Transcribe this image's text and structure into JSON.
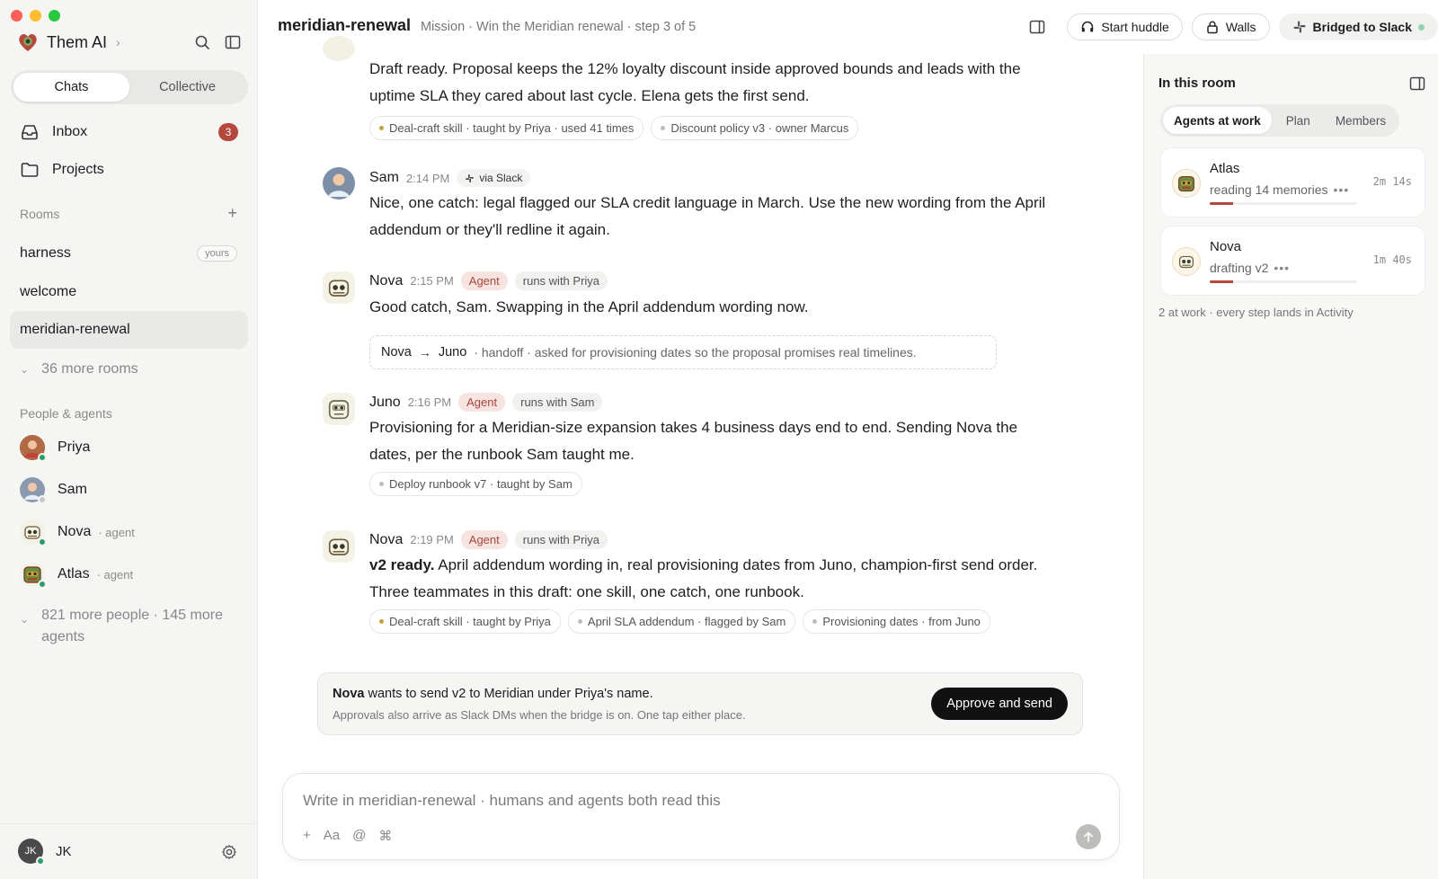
{
  "app": {
    "name": "Them AI"
  },
  "sidebar": {
    "segment": [
      "Chats",
      "Collective"
    ],
    "nav": [
      {
        "label": "Inbox",
        "count": "3"
      },
      {
        "label": "Projects"
      }
    ],
    "rooms_label": "Rooms",
    "rooms": [
      {
        "label": "harness",
        "tag": "yours"
      },
      {
        "label": "welcome"
      },
      {
        "label": "meridian-renewal"
      }
    ],
    "more_rooms": "36 more rooms",
    "people_label": "People & agents",
    "people": [
      {
        "name": "Priya",
        "tag": "",
        "status": "online"
      },
      {
        "name": "Sam",
        "tag": "",
        "status": "offline"
      },
      {
        "name": "Nova",
        "tag": "· agent",
        "status": "online"
      },
      {
        "name": "Atlas",
        "tag": "· agent",
        "status": "online"
      }
    ],
    "more_people": "821 more people · 145 more agents",
    "me": {
      "initials": "JK",
      "name": "JK"
    }
  },
  "header": {
    "room": "meridian-renewal",
    "subtitle": "Mission · Win the Meridian renewal · step 3 of 5",
    "huddle": "Start huddle",
    "walls": "Walls",
    "slack": "Bridged to Slack"
  },
  "messages": [
    {
      "body": "Draft ready. Proposal keeps the 12% loyalty discount inside approved bounds and leads with the uptime SLA they cared about last cycle. Elena gets the first send.",
      "chips": [
        "Deal-craft skill · taught by Priya · used 41 times",
        "Discount policy v3 · owner Marcus"
      ]
    },
    {
      "name": "Sam",
      "time": "2:14 PM",
      "via": "via Slack",
      "body": "Nice, one catch: legal flagged our SLA credit language in March. Use the new wording from the April addendum or they'll redline it again."
    },
    {
      "name": "Nova",
      "time": "2:15 PM",
      "agent_tag": "Agent",
      "runs": "runs with Priya",
      "body": "Good catch, Sam. Swapping in the April addendum wording now.",
      "handoff": {
        "from": "Nova",
        "to": "Juno",
        "text": "· handoff · asked for provisioning dates so the proposal promises real timelines."
      }
    },
    {
      "name": "Juno",
      "time": "2:16 PM",
      "agent_tag": "Agent",
      "runs": "runs with Sam",
      "body": "Provisioning for a Meridian-size expansion takes 4 business days end to end. Sending Nova the dates, per the runbook Sam taught me.",
      "chips": [
        "Deploy runbook v7 · taught by Sam"
      ]
    },
    {
      "name": "Nova",
      "time": "2:19 PM",
      "agent_tag": "Agent",
      "runs": "runs with Priya",
      "body_bold": "v2 ready.",
      "body": " April addendum wording in, real provisioning dates from Juno, champion-first send order. Three teammates in this draft: one skill, one catch, one runbook.",
      "chips": [
        "Deal-craft skill · taught by Priya",
        "April SLA addendum · flagged by Sam",
        "Provisioning dates · from Juno"
      ]
    }
  ],
  "approval": {
    "who": "Nova",
    "text": " wants to send v2 to Meridian under Priya's name.",
    "sub": "Approvals also arrive as Slack DMs when the bridge is on. One tap either place.",
    "button": "Approve and send"
  },
  "composer": {
    "placeholder": "Write in meridian-renewal · humans and agents both read this",
    "tools": [
      "+",
      "Aa",
      "@",
      "⌘"
    ]
  },
  "right_panel": {
    "title": "In this room",
    "tabs": [
      "Agents at work",
      "Plan",
      "Members"
    ],
    "agents": [
      {
        "name": "Atlas",
        "status": "reading 14 memories",
        "elapsed": "2m 14s",
        "progress": 0.16
      },
      {
        "name": "Nova",
        "status": "drafting v2",
        "elapsed": "1m 40s",
        "progress": 0.16
      }
    ],
    "footer": "2 at work · every step lands in Activity"
  },
  "colors": {
    "accent": "#b5483d",
    "agent_tag_bg": "#f7e4e1",
    "online": "#2a9d6a"
  }
}
